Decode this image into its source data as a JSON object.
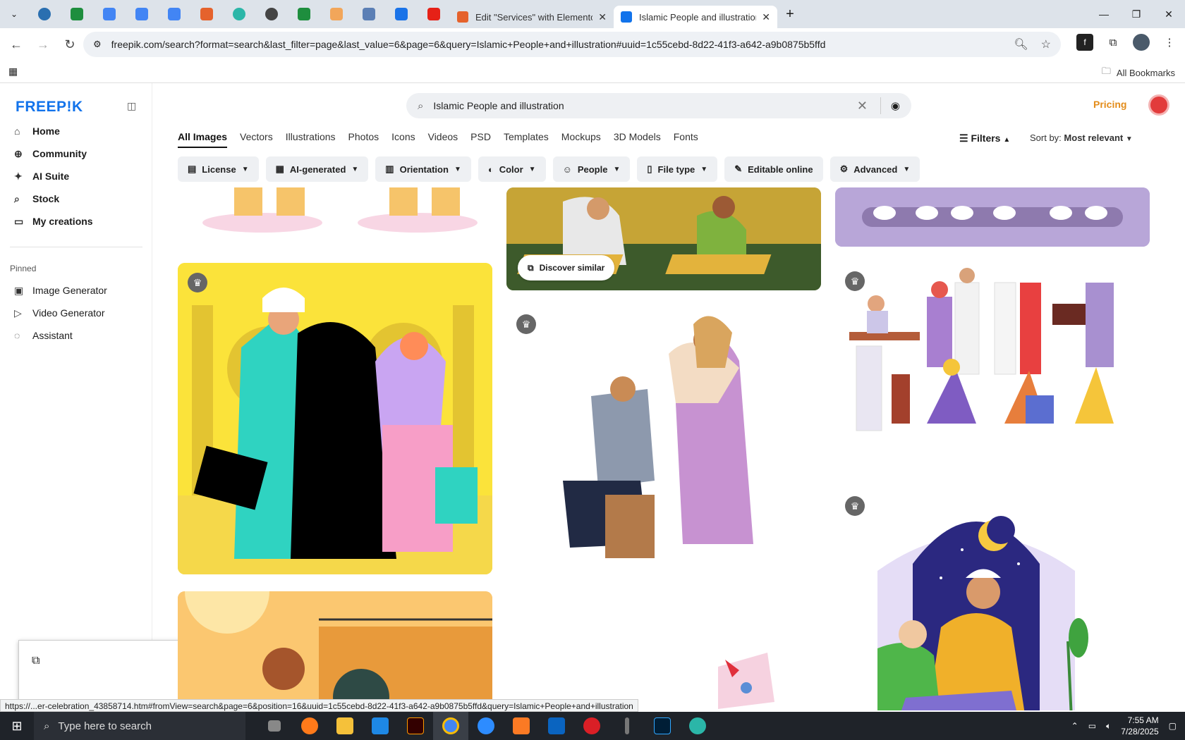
{
  "browser": {
    "tabs": [
      {
        "title": "Edit \"Services\" with Elementor",
        "active": false
      },
      {
        "title": "Islamic People and illustration",
        "active": true
      }
    ],
    "url": "freepik.com/search?format=search&last_filter=page&last_value=6&page=6&query=Islamic+People+and+illustration#uuid=1c55cebd-8d22-41f3-a642-a9b0875b5ffd",
    "bookmarks_label": "All Bookmarks",
    "status_url": "https://...er-celebration_43858714.htm#fromView=search&page=6&position=16&uuid=1c55cebd-8d22-41f3-a642-a9b0875b5ffd&query=Islamic+People+and+illustration"
  },
  "sidebar": {
    "logo": "FREEP!K",
    "nav": [
      {
        "label": "Home",
        "icon": "home-icon"
      },
      {
        "label": "Community",
        "icon": "globe-icon"
      },
      {
        "label": "AI Suite",
        "icon": "sparkle-icon"
      },
      {
        "label": "Stock",
        "icon": "search-icon"
      },
      {
        "label": "My creations",
        "icon": "folder-icon"
      }
    ],
    "pinned_label": "Pinned",
    "pinned": [
      {
        "label": "Image Generator",
        "icon": "image-icon"
      },
      {
        "label": "Video Generator",
        "icon": "video-icon"
      },
      {
        "label": "Assistant",
        "icon": "assistant-icon"
      }
    ]
  },
  "header": {
    "search_value": "Islamic People and illustration",
    "pricing": "Pricing"
  },
  "type_tabs": [
    "All Images",
    "Vectors",
    "Illustrations",
    "Photos",
    "Icons",
    "Videos",
    "PSD",
    "Templates",
    "Mockups",
    "3D Models",
    "Fonts"
  ],
  "filters_label": "Filters",
  "sort": {
    "label": "Sort by:",
    "value": "Most relevant"
  },
  "filter_chips": [
    "License",
    "AI-generated",
    "Orientation",
    "Color",
    "People",
    "File type",
    "Editable online",
    "Advanced"
  ],
  "discover_similar": "Discover similar",
  "taskbar": {
    "search_placeholder": "Type here to search",
    "time": "7:55 AM",
    "date": "7/28/2025"
  }
}
